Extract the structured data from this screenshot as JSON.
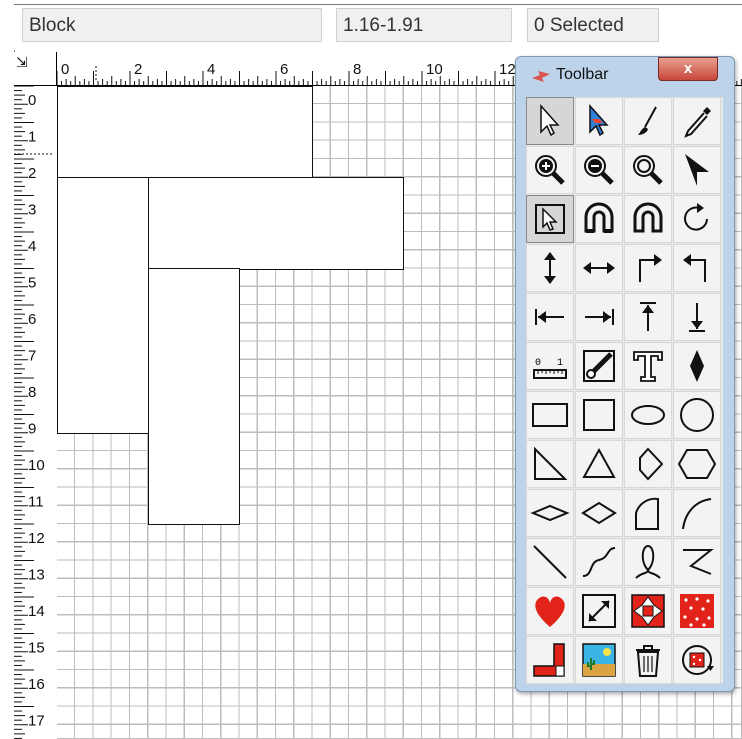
{
  "status": {
    "block_label": "Block",
    "size_label": "1.16-1.91",
    "selection_label": "0 Selected"
  },
  "ruler": {
    "top_labels": [
      "0",
      "2",
      "4",
      "6",
      "8",
      "10",
      "12"
    ],
    "left_labels": [
      "0",
      "1",
      "2",
      "3",
      "4",
      "5",
      "6",
      "7",
      "8",
      "9",
      "10",
      "11",
      "12",
      "13",
      "14",
      "15",
      "16",
      "17"
    ]
  },
  "toolbar": {
    "title": "Toolbar",
    "close": "x",
    "tools": [
      "select-arrow",
      "color-select-arrow",
      "brush",
      "eyedropper",
      "zoom-in",
      "zoom-out",
      "zoom-fit",
      "black-arrow",
      "select-rectangle",
      "magnet",
      "magnet-alt",
      "rotate",
      "vertical-arrow",
      "horizontal-arrow",
      "corner-right",
      "corner-left",
      "arrow-left-bar",
      "arrow-right-bar",
      "arrow-up-bar",
      "arrow-down-bar",
      "ruler",
      "knife",
      "text",
      "diamond-point",
      "rectangle",
      "square",
      "ellipse",
      "circle",
      "right-triangle",
      "triangle",
      "pentagon",
      "hexagon",
      "flat-diamond",
      "diamond",
      "quarter-circle",
      "arc",
      "line",
      "curve",
      "loop",
      "zigzag",
      "heart",
      "resize",
      "star-block",
      "polka-dots",
      "l-shape",
      "picture",
      "trash",
      "fabric-rotate"
    ],
    "colors": {
      "heart": "#e2231a",
      "fabric": "#e2231a",
      "magnet": "#111111"
    }
  }
}
